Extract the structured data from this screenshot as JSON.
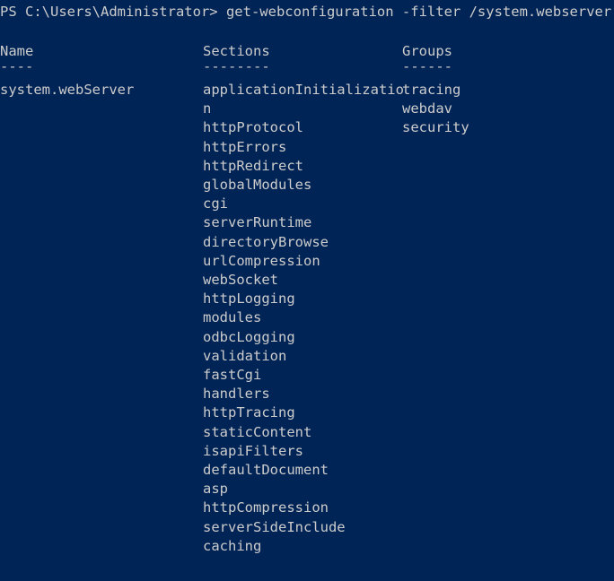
{
  "console": {
    "app": "Windows PowerShell",
    "background_color": "#012456",
    "foreground_color": "#cccccc",
    "prompt": "PS C:\\Users\\Administrator>",
    "command": "get-webconfiguration -filter /system.webserver",
    "prompt_line": "PS C:\\Users\\Administrator> get-webconfiguration -filter /system.webserver"
  },
  "table": {
    "headers": {
      "name": "Name",
      "sections": "Sections",
      "groups": "Groups"
    },
    "rules": {
      "name": "----",
      "sections": "--------",
      "groups": "------"
    },
    "rows": [
      {
        "name": "system.webServer",
        "sections": [
          "applicationInitializatio",
          "n",
          "httpProtocol",
          "httpErrors",
          "httpRedirect",
          "globalModules",
          "cgi",
          "serverRuntime",
          "directoryBrowse",
          "urlCompression",
          "webSocket",
          "httpLogging",
          "modules",
          "odbcLogging",
          "validation",
          "fastCgi",
          "handlers",
          "httpTracing",
          "staticContent",
          "isapiFilters",
          "defaultDocument",
          "asp",
          "httpCompression",
          "serverSideInclude",
          "caching"
        ],
        "groups": [
          "tracing",
          "webdav",
          "security"
        ]
      }
    ]
  }
}
